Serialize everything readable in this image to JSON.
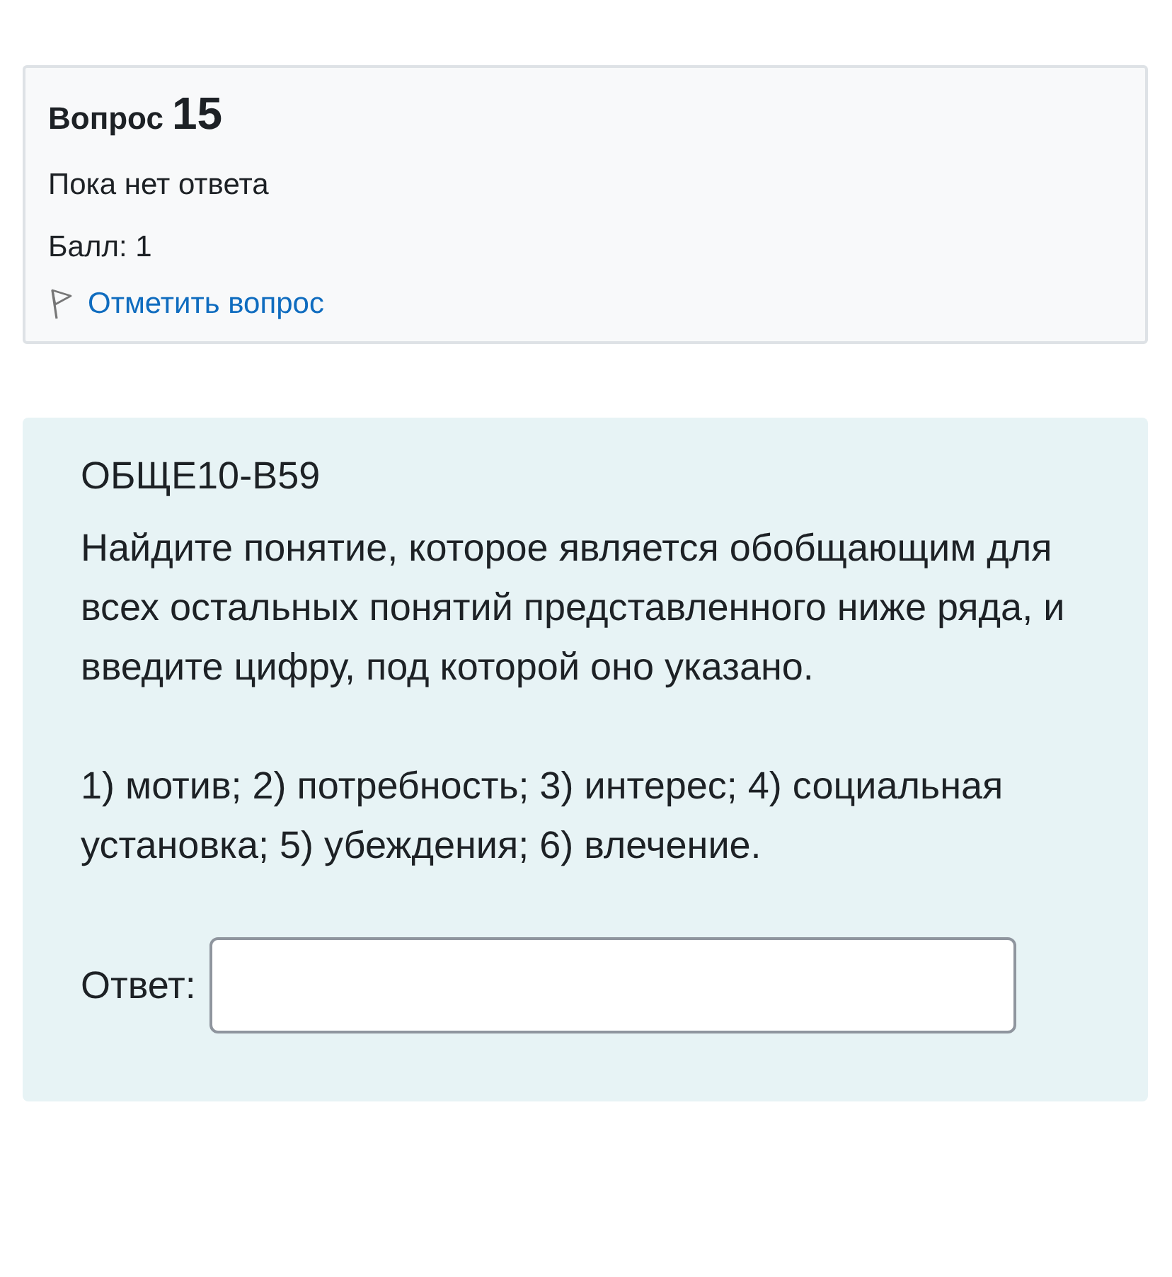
{
  "info": {
    "label": "Вопрос",
    "number": "15",
    "status": "Пока нет ответа",
    "grade": "Балл: 1",
    "flag_link": "Отметить вопрос",
    "flagged": false
  },
  "content": {
    "code": "ОБЩЕ10-B59",
    "question": "Найдите понятие, которое является обобщающим для всех остальных понятий представленного ниже ряда, и введите цифру, под которой оно указано.",
    "options": "1) мотив; 2) потребность; 3) интерес; 4) социальная установка; 5) убеждения; 6) влечение.",
    "answer_label": "Ответ:"
  }
}
